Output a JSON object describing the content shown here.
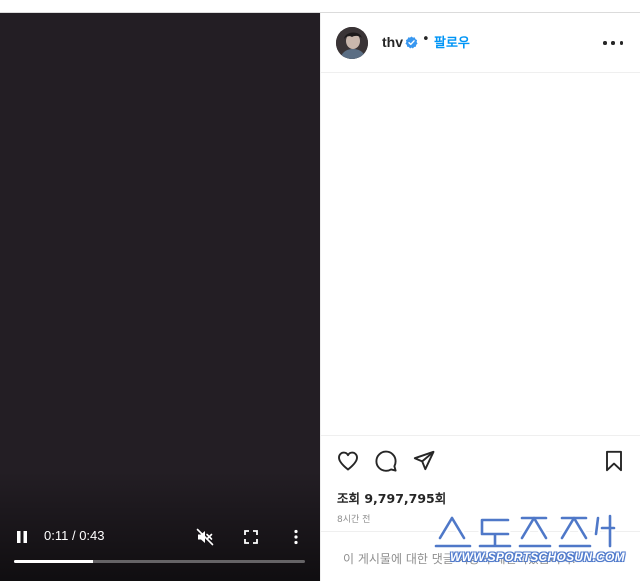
{
  "video": {
    "time_current": "0:11",
    "time_separator": " / ",
    "time_total": "0:43",
    "progress_fraction": 0.27,
    "controls": [
      "pause-icon",
      "muted-speaker-icon",
      "fullscreen-icon",
      "more-vertical-icon"
    ]
  },
  "post": {
    "username": "thv",
    "verified": true,
    "separator": "•",
    "follow_label": "팔로우",
    "views": "조회 9,797,795회",
    "time_ago": "8시간 전",
    "comments_note": "이 게시물에 대한 댓글 기능이 제한되었습니다."
  },
  "actions": [
    "heart-icon",
    "comment-icon",
    "share-icon",
    "bookmark-icon"
  ],
  "watermark": {
    "url": "WWW.SPORTSCHOSUN.COM"
  },
  "colors": {
    "video_bg": "#231e24",
    "link": "#0095f6",
    "verified": "#3897f0",
    "text": "#262626",
    "muted": "#8e8e8e",
    "watermark": "#4f78c8"
  }
}
